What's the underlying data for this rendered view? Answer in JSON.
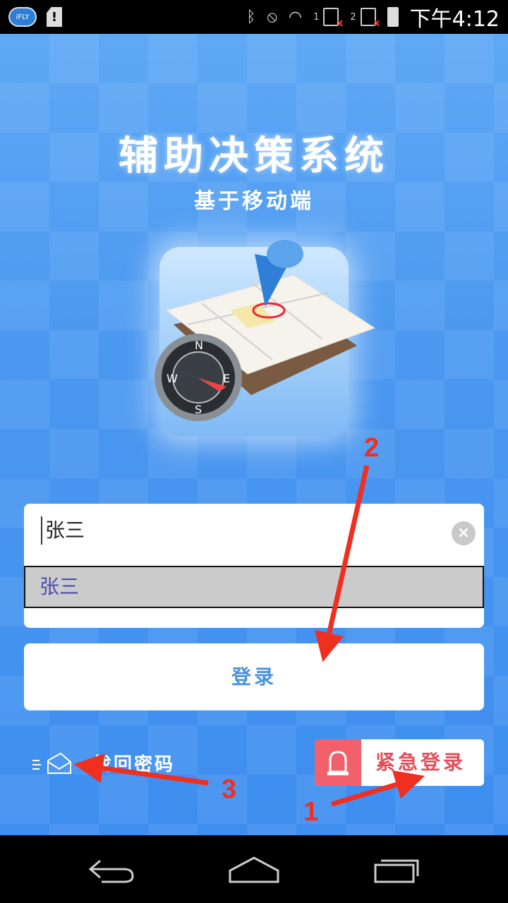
{
  "status_bar": {
    "left_icons": [
      "ifly-icon",
      "sd-card-alert-icon"
    ],
    "ifly_label": "iFLY",
    "sim1_label": "1",
    "sim2_label": "2",
    "time": "下午4:12"
  },
  "app": {
    "title": "辅助决策系统",
    "subtitle": "基于移动端",
    "logo_icon": "map-compass-icon",
    "username": {
      "value": "张三",
      "suggestion": "张三"
    },
    "login_label": "登录",
    "forgot_label": "找回密码",
    "emergency_label": "紧急登录"
  },
  "annotations": [
    "1",
    "2",
    "3"
  ],
  "colors": {
    "accent": "#4a98f0",
    "annotation": "#ef2f1f",
    "emergency": "#f1606b"
  }
}
